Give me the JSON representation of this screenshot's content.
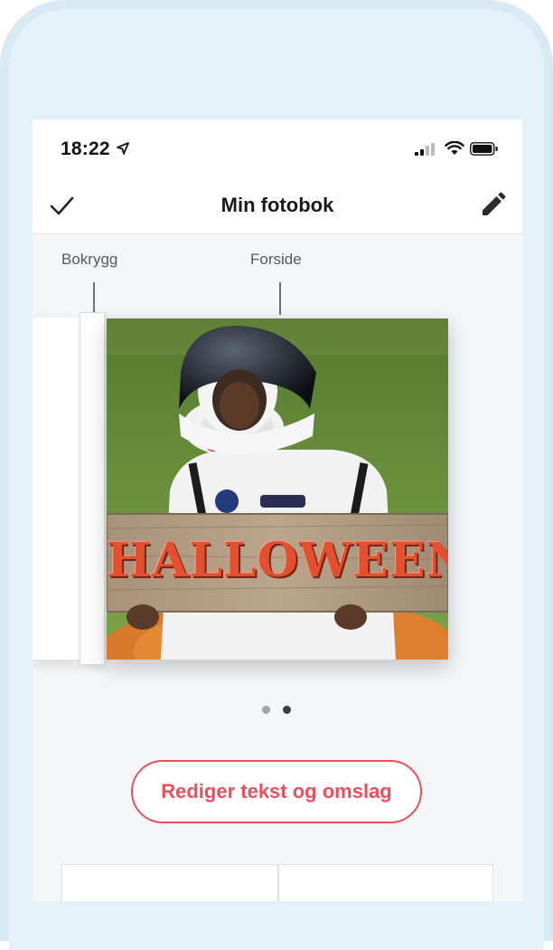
{
  "status_bar": {
    "time": "18:22"
  },
  "nav": {
    "title": "Min fotobok"
  },
  "book": {
    "spine_label": "Bokrygg",
    "front_label": "Forside",
    "cover_text": "HALLOWEEN"
  },
  "pager": {
    "count": 2,
    "active_index": 1
  },
  "actions": {
    "edit_button_label": "Rediger tekst og omslag"
  },
  "icons": [
    "location-arrow-icon",
    "signal-icon",
    "wifi-icon",
    "battery-icon",
    "checkmark-icon",
    "pencil-icon"
  ],
  "colors": {
    "accent": "#e8505b",
    "frame": "#d8ebf5",
    "screen_bg": "#f4f6f8"
  }
}
